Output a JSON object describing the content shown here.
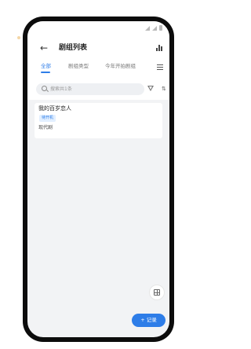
{
  "header": {
    "back_symbol": "←",
    "title": "剧组列表"
  },
  "tabs": [
    {
      "label": "全部",
      "active": true
    },
    {
      "label": "剧组类型",
      "active": false
    },
    {
      "label": "今年开拍剧组",
      "active": false
    }
  ],
  "search": {
    "placeholder": "搜索共1条"
  },
  "sort_symbol": "⇅",
  "list": [
    {
      "title": "我的百岁恋人",
      "badge": "待开机",
      "subtitle": "现代剧"
    }
  ],
  "record_button": {
    "label": "+ 记录"
  },
  "colors": {
    "accent": "#2e7de8",
    "badge_bg": "#e2efff",
    "screen_bg": "#f2f3f5"
  }
}
